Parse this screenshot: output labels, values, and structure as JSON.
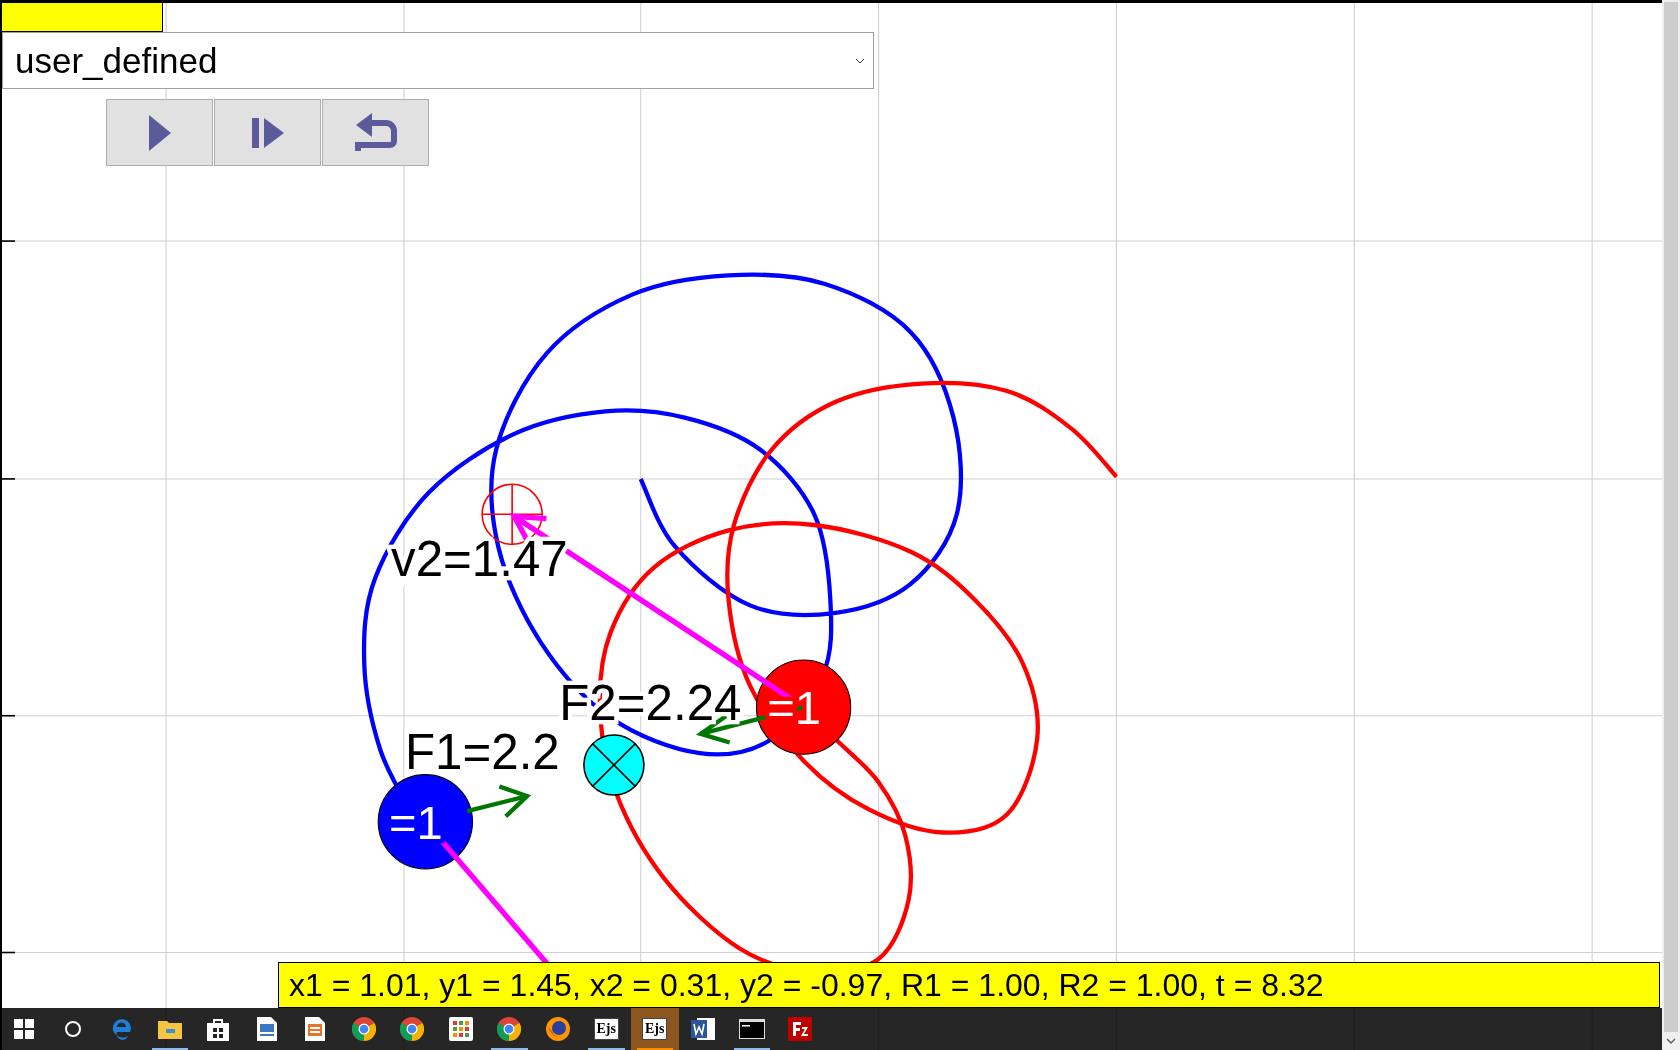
{
  "selector": {
    "value": "user_defined"
  },
  "controls": [
    {
      "kind": "play"
    },
    {
      "kind": "step"
    },
    {
      "kind": "reset"
    }
  ],
  "plot": {
    "labels": [
      {
        "kind": "velocity",
        "text": "v2=1.47"
      },
      {
        "kind": "force2",
        "text": "F2=2.24"
      },
      {
        "kind": "force1",
        "text": "F1=2.2"
      }
    ],
    "bodies": [
      {
        "text": "=1",
        "color": "#0000ff"
      },
      {
        "text": "=1",
        "color": "#ff0000"
      }
    ]
  },
  "status_bar": {
    "text": "x1 = 1.01, y1 = 1.45, x2 = 0.31, y2 = -0.97, R1 = 1.00, R2 = 1.00, t = 8.32"
  },
  "taskbar": {
    "items": [
      {
        "kind": "start",
        "running": false,
        "selected": false
      },
      {
        "kind": "search",
        "running": false,
        "selected": false
      },
      {
        "kind": "edge",
        "running": false,
        "selected": false
      },
      {
        "kind": "folder",
        "running": true,
        "selected": false
      },
      {
        "kind": "store",
        "running": false,
        "selected": false
      },
      {
        "kind": "document",
        "running": false,
        "selected": false
      },
      {
        "kind": "slides",
        "running": false,
        "selected": false
      },
      {
        "kind": "chrome",
        "running": false,
        "selected": false
      },
      {
        "kind": "chrome",
        "running": false,
        "selected": false
      },
      {
        "kind": "grid",
        "running": false,
        "selected": false
      },
      {
        "kind": "chrome",
        "running": true,
        "selected": false
      },
      {
        "kind": "firefox",
        "running": false,
        "selected": false
      },
      {
        "kind": "ejs",
        "label": "Ejs",
        "running": true,
        "selected": false
      },
      {
        "kind": "ejs",
        "label": "Ejs",
        "running": true,
        "selected": true
      },
      {
        "kind": "word",
        "running": false,
        "selected": false
      },
      {
        "kind": "terminal",
        "running": true,
        "selected": false
      },
      {
        "kind": "filezilla",
        "running": false,
        "selected": false
      }
    ]
  }
}
